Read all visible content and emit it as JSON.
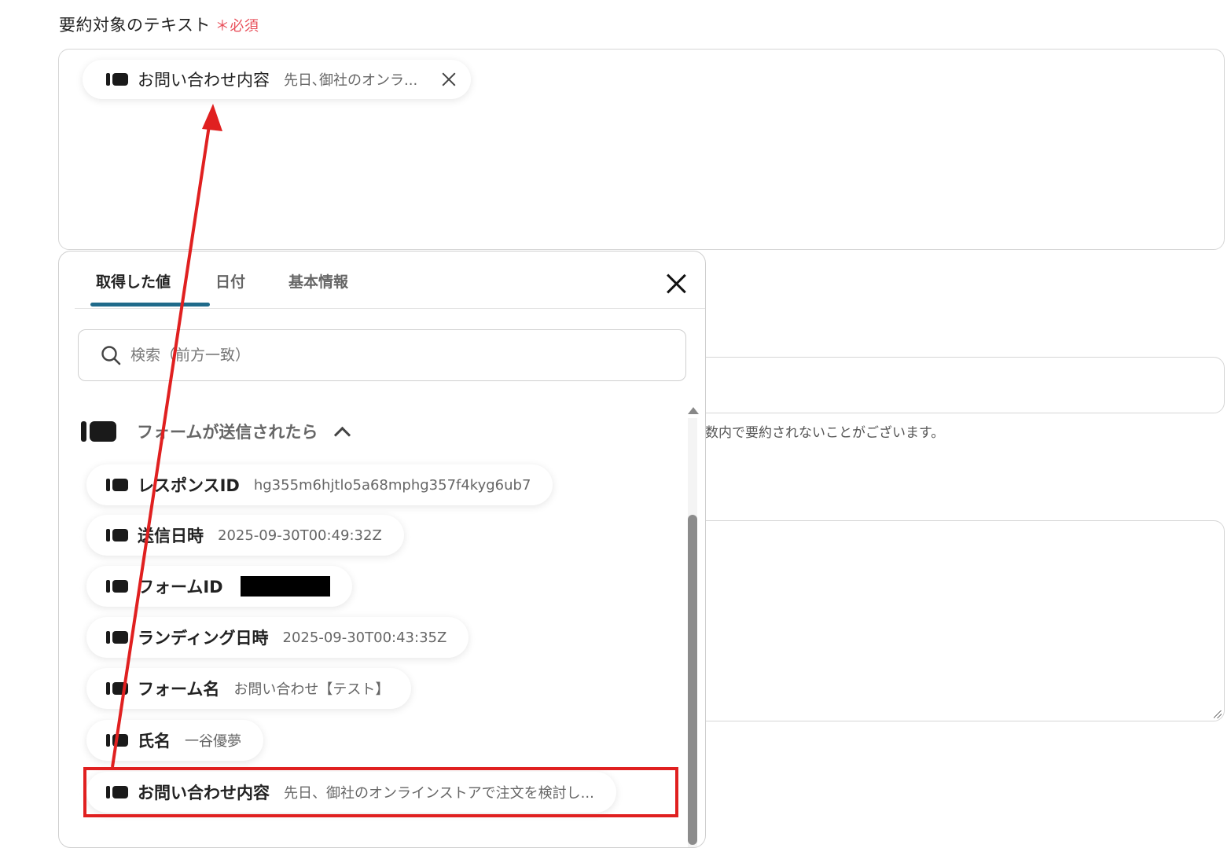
{
  "field": {
    "label": "要約対象のテキスト",
    "required_star": "＊",
    "required_text": "必須"
  },
  "selected_token": {
    "icon": "form-icon",
    "label": "お問い合わせ内容",
    "value": "先日､御社のオンラ..."
  },
  "background": {
    "note": "数内で要約されないことがございます。"
  },
  "panel": {
    "tabs": [
      {
        "label": "取得した値",
        "active": true
      },
      {
        "label": "日付",
        "active": false
      },
      {
        "label": "基本情報",
        "active": false
      }
    ],
    "search": {
      "placeholder": "検索（前方一致）",
      "value": ""
    },
    "group": {
      "label": "フォームが送信されたら",
      "expanded": true
    },
    "items": [
      {
        "label": "レスポンスID",
        "value": "hg355m6hjtlo5a68mphg357f4kyg6ub7"
      },
      {
        "label": "送信日時",
        "value": "2025-09-30T00:49:32Z"
      },
      {
        "label": "フォームID",
        "value": "",
        "redacted": true
      },
      {
        "label": "ランディング日時",
        "value": "2025-09-30T00:43:35Z"
      },
      {
        "label": "フォーム名",
        "value": "お問い合わせ【テスト】"
      },
      {
        "label": "氏名",
        "value": "一谷優夢"
      },
      {
        "label": "お問い合わせ内容",
        "value": "先日、御社のオンラインストアで注文を検討し..."
      }
    ]
  },
  "colors": {
    "required": "#e8505b",
    "tab_underline": "#1f6a8a",
    "annotation": "#e02020"
  }
}
